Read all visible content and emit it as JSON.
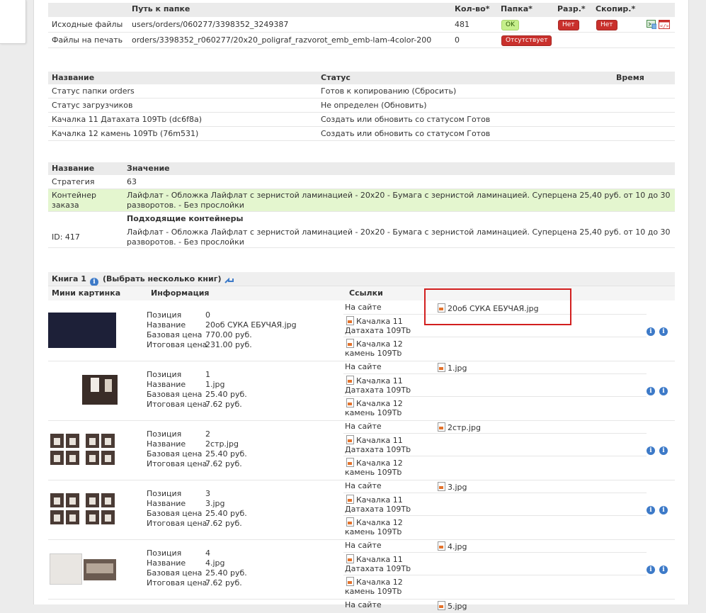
{
  "files": {
    "headers": [
      "Путь к папке",
      "Кол-во*",
      "Папка*",
      "Разр.*",
      "Скопир.*"
    ],
    "rows": [
      {
        "name": "Исходные файлы",
        "path": "users/orders/060277/3398352_3249387",
        "count": "481",
        "folder": "OK",
        "perm": "Нет",
        "copied": "Нет"
      },
      {
        "name": "Файлы на печать",
        "path": "orders/3398352_r060277/20x20_poligraf_razvorot_emb_emb-lam-4color-200",
        "count": "0",
        "folder": "Отсутствует"
      }
    ]
  },
  "status": {
    "headers": [
      "Название",
      "Статус",
      "Время"
    ],
    "rows": [
      {
        "name": "Статус папки orders",
        "status": "Готов к копированию (Сбросить)"
      },
      {
        "name": "Статус загрузчиков",
        "status": "Не определен (Обновить)"
      },
      {
        "name": "Качалка 11 Датахата 109Tb (dc6f8a)",
        "status": "Создать или обновить со статусом Готов"
      },
      {
        "name": "Качалка 12 камень 109Tb (76m531)",
        "status": "Создать или обновить со статусом Готов"
      }
    ]
  },
  "params": {
    "headers": [
      "Название",
      "Значение"
    ],
    "strategy_label": "Стратегия",
    "strategy_value": "63",
    "container_label_1": "Контейнер",
    "container_label_2": "заказа",
    "container_value_1": "Лайфлат - Обложка Лайфлат с зернистой ламинацией - 20x20 - Бумага с зернистой ламинацией. Суперцена 25,40 руб. от 10 до 30",
    "container_value_2": "разворотов. - Без прослойки",
    "suitable_title": "Подходящие контейнеры",
    "suitable_id": "ID: 417",
    "suitable_value_1": "Лайфлат - Обложка Лайфлат с зернистой ламинацией - 20x20 - Бумага с зернистой ламинацией. Суперцена 25,40 руб. от 10 до 30",
    "suitable_value_2": "разворотов. - Без прослойки"
  },
  "book": {
    "title": "Книга 1",
    "select_many": "(Выбрать несколько книг)",
    "headers": [
      "Мини картинка",
      "Информация",
      "Ссылки"
    ],
    "labels": {
      "position": "Позиция",
      "name": "Название",
      "base": "Базовая цена",
      "total": "Итоговая цена"
    },
    "link_labels": {
      "site": "На сайте",
      "k11a": "Качалка 11",
      "k11b": "Датахата 109Tb",
      "k12a": "Качалка 12",
      "k12b": "камень 109Tb"
    },
    "items": [
      {
        "pos": "0",
        "name": "20об СУКА ЕБУЧАЯ.jpg",
        "base": "770.00 руб.",
        "total": "231.00 руб.",
        "file": "20об СУКА ЕБУЧАЯ.jpg"
      },
      {
        "pos": "1",
        "name": "1.jpg",
        "base": "25.40 руб.",
        "total": "7.62 руб.",
        "file": "1.jpg"
      },
      {
        "pos": "2",
        "name": "2стр.jpg",
        "base": "25.40 руб.",
        "total": "7.62 руб.",
        "file": "2стр.jpg"
      },
      {
        "pos": "3",
        "name": "3.jpg",
        "base": "25.40 руб.",
        "total": "7.62 руб.",
        "file": "3.jpg"
      },
      {
        "pos": "4",
        "name": "4.jpg",
        "base": "25.40 руб.",
        "total": "7.62 руб.",
        "file": "4.jpg"
      }
    ],
    "next_site": "На сайте",
    "next_file": "5.jpg"
  },
  "colors": {
    "accent": "#3d7ac8",
    "danger": "#c9302c",
    "ok": "#c6ef8c",
    "highlight": "#e4f6cf",
    "annotation": "#d21f1f"
  }
}
